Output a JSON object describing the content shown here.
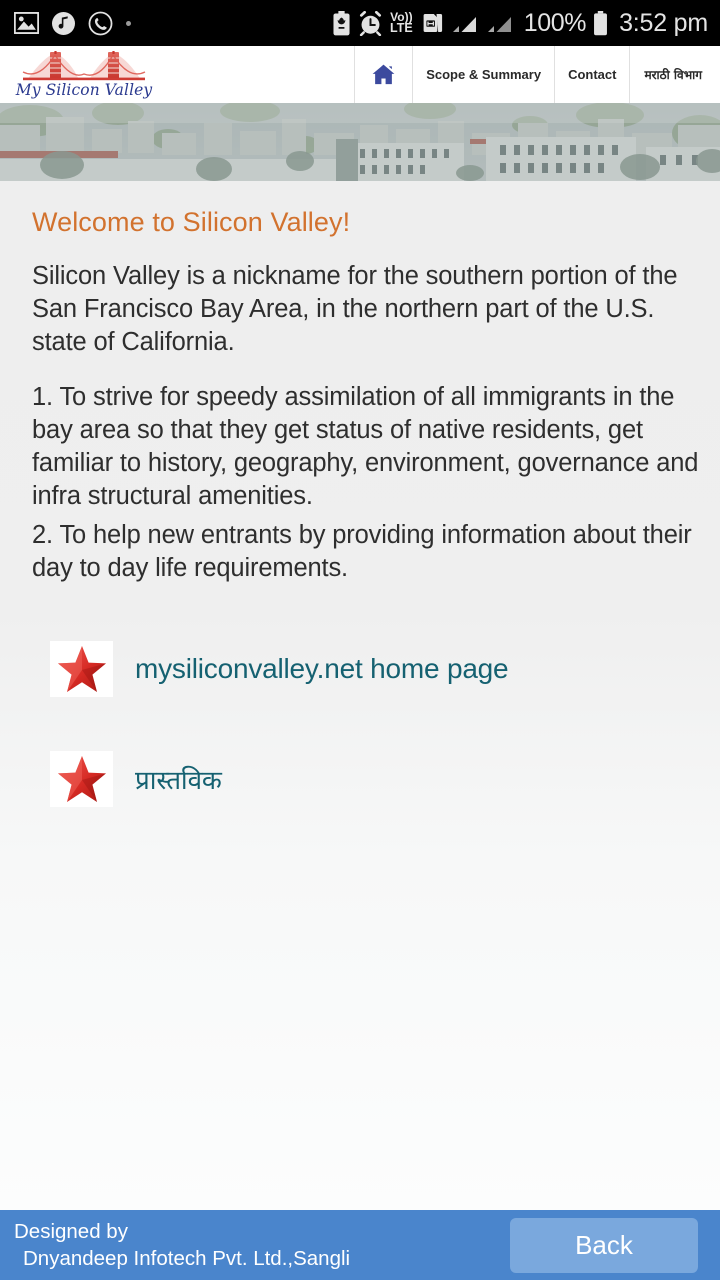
{
  "statusbar": {
    "left_icons": [
      "photo-icon",
      "music-note-icon",
      "missed-call-icon",
      "more-dot-icon"
    ],
    "right_icons": [
      "battery-saver-icon",
      "alarm-icon",
      "volte-icon",
      "sd-card-icon",
      "signal-sim1-icon",
      "signal-sim2-icon"
    ],
    "volte_top": "Vo))",
    "volte_bottom": "LTE",
    "battery_percent": "100%",
    "time": "3:52 pm"
  },
  "header": {
    "logo_wordmark": "My Silicon Valley",
    "logo_icon": "golden-gate-bridge-logo",
    "nav": [
      {
        "label": "",
        "icon": "home-icon",
        "name": "nav-home"
      },
      {
        "label": "Scope & Summary",
        "icon": "",
        "name": "nav-scope-summary"
      },
      {
        "label": "Contact",
        "icon": "",
        "name": "nav-contact"
      },
      {
        "label": "मराठी विभाग",
        "icon": "",
        "name": "nav-marathi-vibhag"
      }
    ]
  },
  "hero": {
    "alt": "san-francisco-cityscape-photo"
  },
  "main": {
    "heading": "Welcome to Silicon Valley!",
    "intro": "Silicon Valley is a nickname for the southern portion of the San Francisco Bay Area, in the northern part of the U.S. state of California.",
    "point1": "1. To strive for speedy assimilation of all immigrants in the bay area so that they get status of native residents, get familiar to history, geography, environment, governance and infra structural amenities.",
    "point2": "2. To help new entrants by providing information about their day to day life requirements.",
    "links": [
      {
        "label": "mysiliconvalley.net home page",
        "icon": "red-star-icon"
      },
      {
        "label": "प्रास्तविक",
        "icon": "red-star-icon"
      }
    ]
  },
  "footer": {
    "credit_line1": "Designed by",
    "credit_line2": "Dnyandeep Infotech Pvt. Ltd.,Sangli",
    "back_label": "Back"
  },
  "colors": {
    "statusbar_bg": "#000000",
    "heading_orange": "#d2722e",
    "link_teal": "#156171",
    "footer_blue": "#4a85cc",
    "back_button_blue": "#7aa8dd",
    "logo_blue": "#2b3a8f",
    "bridge_red": "#cf3b34",
    "home_icon_blue": "#3c4a9e"
  }
}
